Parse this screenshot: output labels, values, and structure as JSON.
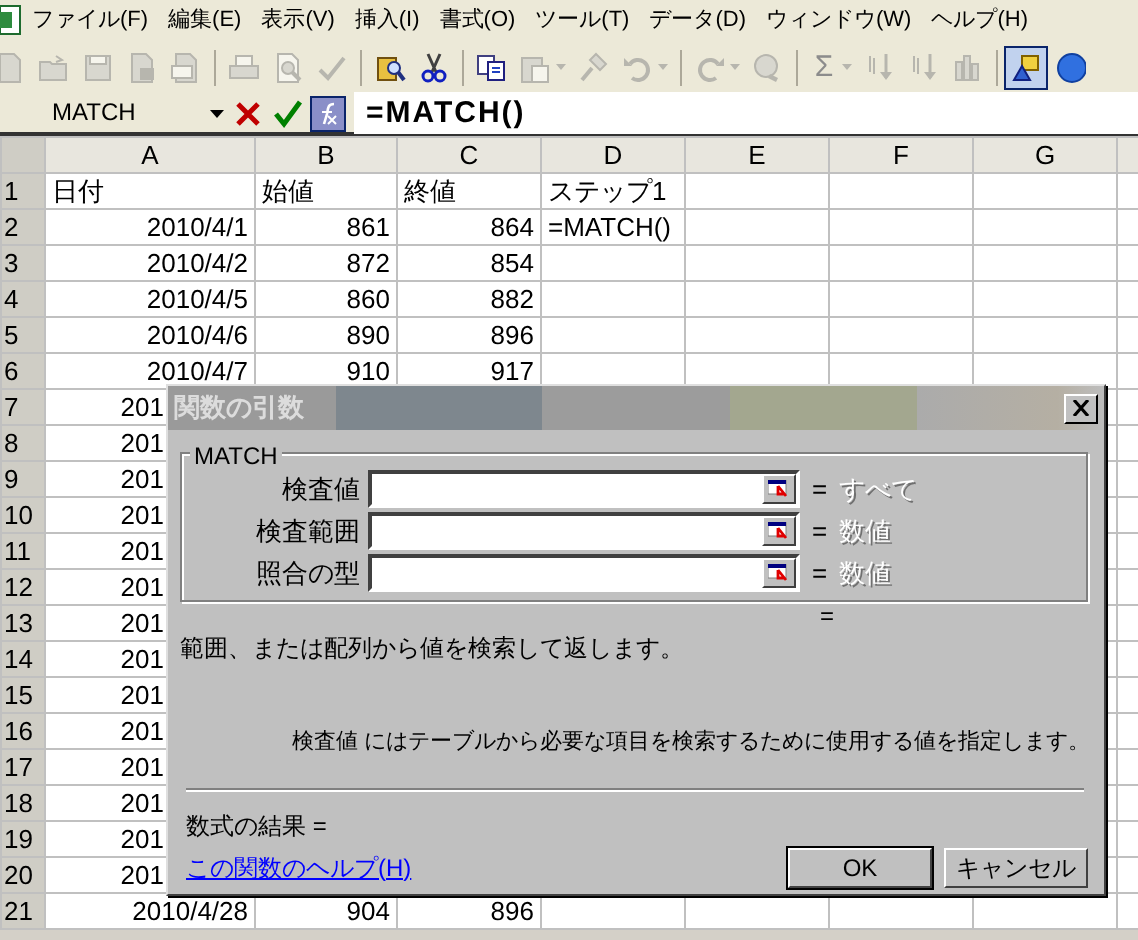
{
  "menu": [
    {
      "label": "ファイル(F)"
    },
    {
      "label": "編集(E)"
    },
    {
      "label": "表示(V)"
    },
    {
      "label": "挿入(I)"
    },
    {
      "label": "書式(O)"
    },
    {
      "label": "ツール(T)"
    },
    {
      "label": "データ(D)"
    },
    {
      "label": "ウィンドウ(W)"
    },
    {
      "label": "ヘルプ(H)"
    }
  ],
  "toolbar": [
    {
      "disabled": true,
      "selected": false
    },
    {
      "disabled": true,
      "selected": false
    },
    {
      "disabled": true,
      "selected": false
    },
    {
      "disabled": true,
      "selected": false
    },
    {
      "disabled": true,
      "selected": false
    },
    {
      "disabled": true,
      "selected": false
    },
    {
      "disabled": true,
      "selected": false
    },
    {
      "disabled": true,
      "selected": false
    },
    {
      "disabled": false,
      "selected": false
    },
    {
      "disabled": false,
      "selected": false
    },
    {
      "disabled": false,
      "selected": false
    },
    {
      "disabled": true,
      "selected": false
    },
    {
      "disabled": true,
      "selected": false
    },
    {
      "disabled": true,
      "selected": false
    },
    {
      "disabled": true,
      "selected": false
    },
    {
      "disabled": true,
      "selected": false
    },
    {
      "disabled": true,
      "selected": false,
      "label": "Σ"
    },
    {
      "disabled": true,
      "selected": false
    },
    {
      "disabled": true,
      "selected": false
    },
    {
      "disabled": true,
      "selected": false
    },
    {
      "disabled": false,
      "selected": true
    },
    {
      "disabled": false,
      "selected": false
    }
  ],
  "formula_bar": {
    "name_box": "MATCH",
    "formula": "=MATCH()"
  },
  "grid": {
    "columns": [
      "A",
      "B",
      "C",
      "D",
      "E",
      "F",
      "G"
    ],
    "rows": [
      {
        "number": "1",
        "kind": "header",
        "cells": [
          "日付",
          "始値",
          "終値",
          "ステップ1"
        ]
      },
      {
        "number": "2",
        "kind": "data",
        "cells": [
          "2010/4/1",
          "861",
          "864",
          "=MATCH()"
        ]
      },
      {
        "number": "3",
        "kind": "data",
        "cells": [
          "2010/4/2",
          "872",
          "854"
        ]
      },
      {
        "number": "4",
        "kind": "data",
        "cells": [
          "2010/4/5",
          "860",
          "882"
        ]
      },
      {
        "number": "5",
        "kind": "data",
        "cells": [
          "2010/4/6",
          "890",
          "896"
        ]
      },
      {
        "number": "6",
        "kind": "data",
        "cells": [
          "2010/4/7",
          "910",
          "917"
        ]
      },
      {
        "number": "7",
        "kind": "data",
        "cells": [
          "201"
        ]
      },
      {
        "number": "8",
        "kind": "data",
        "cells": [
          "201"
        ]
      },
      {
        "number": "9",
        "kind": "data",
        "cells": [
          "201"
        ]
      },
      {
        "number": "10",
        "kind": "data",
        "cells": [
          "201"
        ]
      },
      {
        "number": "11",
        "kind": "data",
        "cells": [
          "201"
        ]
      },
      {
        "number": "12",
        "kind": "data",
        "cells": [
          "201"
        ]
      },
      {
        "number": "13",
        "kind": "data",
        "cells": [
          "201"
        ]
      },
      {
        "number": "14",
        "kind": "data",
        "cells": [
          "201"
        ]
      },
      {
        "number": "15",
        "kind": "data",
        "cells": [
          "201"
        ]
      },
      {
        "number": "16",
        "kind": "data",
        "cells": [
          "201"
        ]
      },
      {
        "number": "17",
        "kind": "data",
        "cells": [
          "201"
        ]
      },
      {
        "number": "18",
        "kind": "data",
        "cells": [
          "201"
        ]
      },
      {
        "number": "19",
        "kind": "data",
        "cells": [
          "201"
        ]
      },
      {
        "number": "20",
        "kind": "data",
        "cells": [
          "201"
        ]
      },
      {
        "number": "21",
        "kind": "data",
        "cells": [
          "2010/4/28",
          "904",
          "896"
        ]
      }
    ]
  },
  "dialog": {
    "title": "関数の引数",
    "group_label": "MATCH",
    "arguments": [
      {
        "label": "検査値",
        "equals": "=",
        "result": "すべて"
      },
      {
        "label": "検査範囲",
        "equals": "=",
        "result": "数値"
      },
      {
        "label": "照合の型",
        "equals": "=",
        "result": "数値"
      }
    ],
    "result_equals": "=",
    "description": "範囲、または配列から値を検索して返します。",
    "argument_help": "検査値 にはテーブルから必要な項目を検索するために使用する値を指定します。",
    "formula_result": "数式の結果 =",
    "help_link": "この関数のヘルプ(H)",
    "buttons": [
      {
        "label": "OK",
        "default": true
      },
      {
        "label": "キャンセル",
        "default": false
      }
    ]
  }
}
